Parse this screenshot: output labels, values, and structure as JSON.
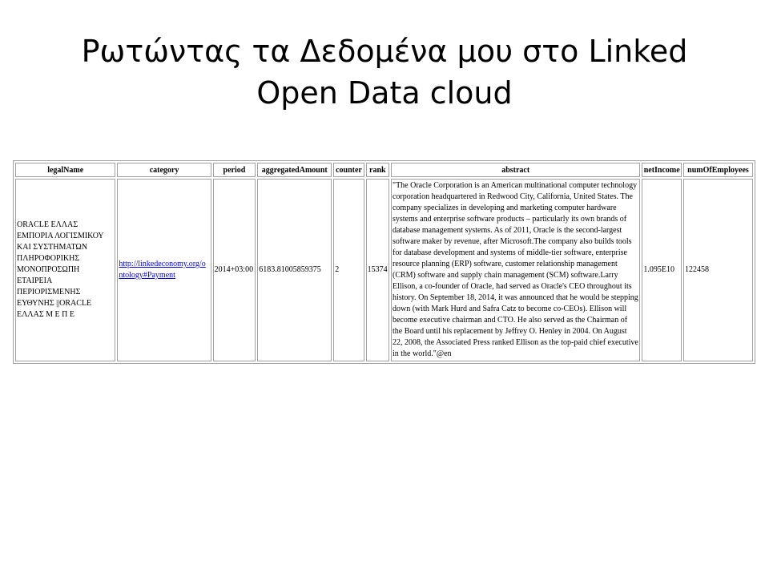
{
  "slide": {
    "title_line1": "Ρωτώντας τα Δεδομένα μου στο Linked",
    "title_line2": "Open Data cloud"
  },
  "table": {
    "headers": [
      "legalName",
      "category",
      "period",
      "aggregatedAmount",
      "counter",
      "rank",
      "abstract",
      "netIncome",
      "numOfEmployees"
    ],
    "rows": [
      {
        "legalName": "ORACLE ΕΛΛΑΣ ΕΜΠΟΡΙΑ ΛΟΓΙΣΜΙΚΟΥ ΚΑΙ ΣΥΣΤΗΜΑΤΩΝ ΠΛΗΡΟΦΟΡΙΚΗΣ ΜΟΝΟΠΡΟΣΩΠΗ ΕΤΑΙΡΕΙΑ ΠΕΡΙΟΡΙΣΜΕΝΗΣ ΕΥΘΥΝΗΣ ||ORACLE ΕΛΛΑΣ Μ Ε Π Ε",
        "category": "http://linkedeconomy.org/ontology#Payment",
        "period": "2014+03:00",
        "aggregatedAmount": "6183.81005859375",
        "counter": "2",
        "rank": "15374",
        "abstract": "\"The Oracle Corporation is an American multinational computer technology corporation headquartered in Redwood City, California, United States. The company specializes in developing and marketing computer hardware systems and enterprise software products – particularly its own brands of database management systems. As of 2011, Oracle is the second-largest software maker by revenue, after Microsoft.The company also builds tools for database development and systems of middle-tier software, enterprise resource planning (ERP) software, customer relationship management (CRM) software and supply chain management (SCM) software.Larry Ellison, a co-founder of Oracle, had served as Oracle's CEO throughout its history. On September 18, 2014, it was announced that he would be stepping down (with Mark Hurd and Safra Catz to become co-CEOs). Ellison will become executive chairman and CTO. He also served as the Chairman of the Board until his replacement by Jeffrey O. Henley in 2004. On August 22, 2008, the Associated Press ranked Ellison as the top-paid chief executive in the world.\"@en",
        "netIncome": "1.095E10",
        "numOfEmployees": "122458"
      }
    ]
  }
}
